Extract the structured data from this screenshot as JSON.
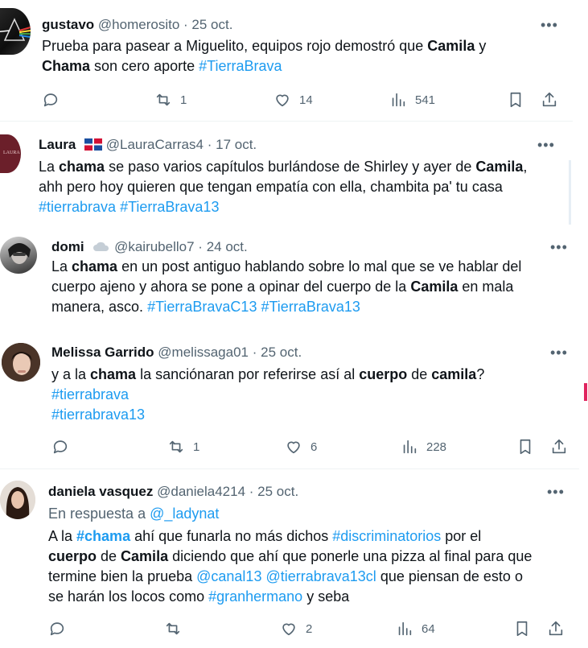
{
  "tweets": [
    {
      "name": "gustavo",
      "handle": "@homerosito",
      "sep": "·",
      "date": "25 oct.",
      "more": "•••",
      "lines": [
        [
          {
            "t": "Prueba para pasear a Miguelito, equipos rojo demostró que "
          },
          {
            "t": "Camila",
            "b": true
          },
          {
            "t": " y"
          }
        ],
        [
          {
            "t": "Chama",
            "b": true
          },
          {
            "t": " son cero aporte "
          },
          {
            "t": "#TierraBrava",
            "tag": true
          }
        ]
      ],
      "reply_count": "",
      "retweets": "1",
      "likes": "14",
      "views": "541"
    },
    {
      "name": "Laura",
      "handle": "@LauraCarras4",
      "sep": "·",
      "date": "17 oct.",
      "more": "•••",
      "avatar_text": "LAURA",
      "lines": [
        [
          {
            "t": "La "
          },
          {
            "t": "chama",
            "b": true
          },
          {
            "t": " se paso varios capítulos burlándose de Shirley y ayer de "
          },
          {
            "t": "Camila",
            "b": true
          },
          {
            "t": ","
          }
        ],
        [
          {
            "t": "ahh pero hoy quieren que tengan empatía con ella, chambita pa' tu casa"
          }
        ],
        [
          {
            "t": "#tierrabrava",
            "tag": true
          },
          {
            "t": " "
          },
          {
            "t": "#TierraBrava13",
            "tag": true
          }
        ]
      ]
    },
    {
      "name": "domi",
      "handle": "@kairubello7",
      "sep": "·",
      "date": "24 oct.",
      "more": "•••",
      "lines": [
        [
          {
            "t": "La "
          },
          {
            "t": "chama",
            "b": true
          },
          {
            "t": " en un post antiguo hablando sobre lo mal que se ve hablar del"
          }
        ],
        [
          {
            "t": "cuerpo ajeno y ahora se pone a opinar del cuerpo de la "
          },
          {
            "t": "Camila",
            "b": true
          },
          {
            "t": " en mala"
          }
        ],
        [
          {
            "t": "manera, asco. "
          },
          {
            "t": "#TierraBravaC13",
            "tag": true
          },
          {
            "t": " "
          },
          {
            "t": "#TierraBrava13",
            "tag": true
          }
        ]
      ]
    },
    {
      "name": "Melissa Garrido",
      "handle": "@melissaga01",
      "sep": "·",
      "date": "25 oct.",
      "more": "•••",
      "lines": [
        [
          {
            "t": "y a la "
          },
          {
            "t": "chama",
            "b": true
          },
          {
            "t": " la sanciónaran por referirse así al "
          },
          {
            "t": "cuerpo",
            "b": true
          },
          {
            "t": " de "
          },
          {
            "t": "camila",
            "b": true
          },
          {
            "t": "?"
          }
        ],
        [
          {
            "t": "#tierrabrava",
            "tag": true
          }
        ],
        [
          {
            "t": "#tierrabrava13",
            "tag": true
          }
        ]
      ],
      "reply_count": "",
      "retweets": "1",
      "likes": "6",
      "views": "228"
    },
    {
      "name": "daniela vasquez",
      "handle": "@daniela4214",
      "sep": "·",
      "date": "25 oct.",
      "more": "•••",
      "reply_prefix": "En respuesta a ",
      "reply_to": "@_ladynat",
      "lines": [
        [
          {
            "t": "A la "
          },
          {
            "t": "#chama",
            "tag": true,
            "b": true
          },
          {
            "t": " ahí que funarla no más dichos "
          },
          {
            "t": "#discriminatorios",
            "tag": true
          },
          {
            "t": " por el"
          }
        ],
        [
          {
            "t": "cuerpo",
            "b": true
          },
          {
            "t": " de "
          },
          {
            "t": "Camila",
            "b": true
          },
          {
            "t": " diciendo que ahí que ponerle una pizza al final para que"
          }
        ],
        [
          {
            "t": "termine bien la prueba "
          },
          {
            "t": "@canal13",
            "tag": true
          },
          {
            "t": "  "
          },
          {
            "t": "@tierrabrava13cl",
            "tag": true
          },
          {
            "t": "  que piensan de esto o"
          }
        ],
        [
          {
            "t": "se harán los locos como "
          },
          {
            "t": "#granhermano",
            "tag": true
          },
          {
            "t": " y seba"
          }
        ]
      ],
      "reply_count": "",
      "retweets": "",
      "likes": "2",
      "views": "64"
    }
  ],
  "colors": {
    "link": "#1d9bf0",
    "secondary": "#536471",
    "text": "#0f1419"
  },
  "icons": [
    "reply-icon",
    "retweet-icon",
    "like-icon",
    "views-icon",
    "bookmark-icon",
    "share-icon",
    "more-icon"
  ]
}
